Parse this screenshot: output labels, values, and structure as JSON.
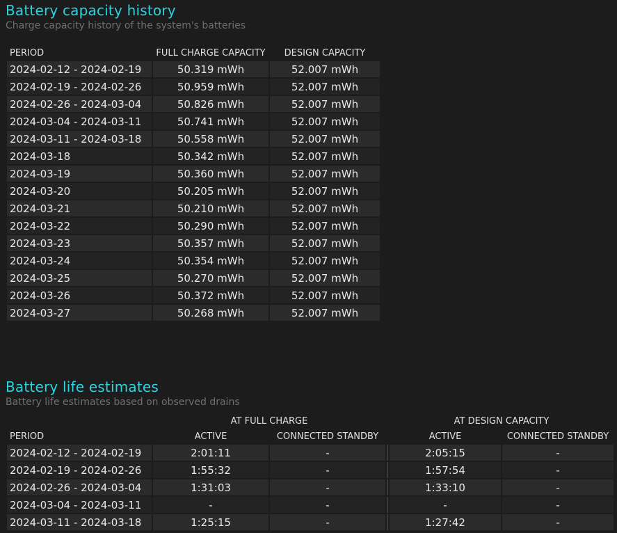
{
  "capacity": {
    "title": "Battery capacity history",
    "subtitle": "Charge capacity history of the system's batteries",
    "headers": [
      "PERIOD",
      "FULL CHARGE CAPACITY",
      "DESIGN CAPACITY"
    ],
    "rows": [
      [
        "2024-02-12 - 2024-02-19",
        "50.319 mWh",
        "52.007 mWh"
      ],
      [
        "2024-02-19 - 2024-02-26",
        "50.959 mWh",
        "52.007 mWh"
      ],
      [
        "2024-02-26 - 2024-03-04",
        "50.826 mWh",
        "52.007 mWh"
      ],
      [
        "2024-03-04 - 2024-03-11",
        "50.741 mWh",
        "52.007 mWh"
      ],
      [
        "2024-03-11 - 2024-03-18",
        "50.558 mWh",
        "52.007 mWh"
      ],
      [
        "2024-03-18",
        "50.342 mWh",
        "52.007 mWh"
      ],
      [
        "2024-03-19",
        "50.360 mWh",
        "52.007 mWh"
      ],
      [
        "2024-03-20",
        "50.205 mWh",
        "52.007 mWh"
      ],
      [
        "2024-03-21",
        "50.210 mWh",
        "52.007 mWh"
      ],
      [
        "2024-03-22",
        "50.290 mWh",
        "52.007 mWh"
      ],
      [
        "2024-03-23",
        "50.357 mWh",
        "52.007 mWh"
      ],
      [
        "2024-03-24",
        "50.354 mWh",
        "52.007 mWh"
      ],
      [
        "2024-03-25",
        "50.270 mWh",
        "52.007 mWh"
      ],
      [
        "2024-03-26",
        "50.372 mWh",
        "52.007 mWh"
      ],
      [
        "2024-03-27",
        "50.268 mWh",
        "52.007 mWh"
      ]
    ]
  },
  "estimates": {
    "title": "Battery life estimates",
    "subtitle": "Battery life estimates based on observed drains",
    "group_headers": [
      "AT FULL CHARGE",
      "AT DESIGN CAPACITY"
    ],
    "headers": [
      "PERIOD",
      "ACTIVE",
      "CONNECTED STANDBY",
      "ACTIVE",
      "CONNECTED STANDBY"
    ],
    "rows": [
      [
        "2024-02-12 - 2024-02-19",
        "2:01:11",
        "-",
        "2:05:15",
        "-"
      ],
      [
        "2024-02-19 - 2024-02-26",
        "1:55:32",
        "-",
        "1:57:54",
        "-"
      ],
      [
        "2024-02-26 - 2024-03-04",
        "1:31:03",
        "-",
        "1:33:10",
        "-"
      ],
      [
        "2024-03-04 - 2024-03-11",
        "-",
        "-",
        "-",
        "-"
      ],
      [
        "2024-03-11 - 2024-03-18",
        "1:25:15",
        "-",
        "1:27:42",
        "-"
      ]
    ]
  }
}
